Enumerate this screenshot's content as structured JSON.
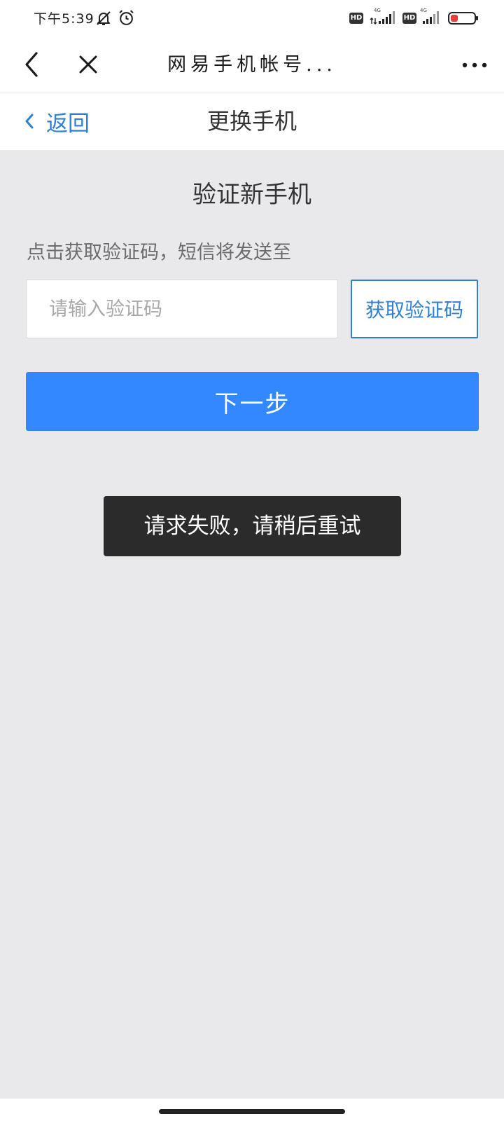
{
  "status_bar": {
    "time": "下午5:39",
    "icons": [
      "bell-off-icon",
      "alarm-icon",
      "hd-badge",
      "signal-icon",
      "hd-badge",
      "signal-icon",
      "battery-icon"
    ],
    "hd_label": "HD",
    "network_label": "4G"
  },
  "title_bar": {
    "title": "网易手机帐号...",
    "icons": [
      "back-chevron-icon",
      "close-icon",
      "more-dots-icon"
    ]
  },
  "header": {
    "back_label": "返回",
    "title": "更换手机"
  },
  "form": {
    "section_title": "验证新手机",
    "hint": "点击获取验证码，短信将发送至",
    "code_placeholder": "请输入验证码",
    "code_value": "",
    "get_code_label": "获取验证码",
    "next_label": "下一步"
  },
  "toast": {
    "message": "请求失败，请稍后重试"
  },
  "colors": {
    "accent": "#2f7fd3",
    "primary_button": "#3388ff",
    "page_background": "#e9e9ec",
    "toast_background": "#2b2b2b"
  }
}
